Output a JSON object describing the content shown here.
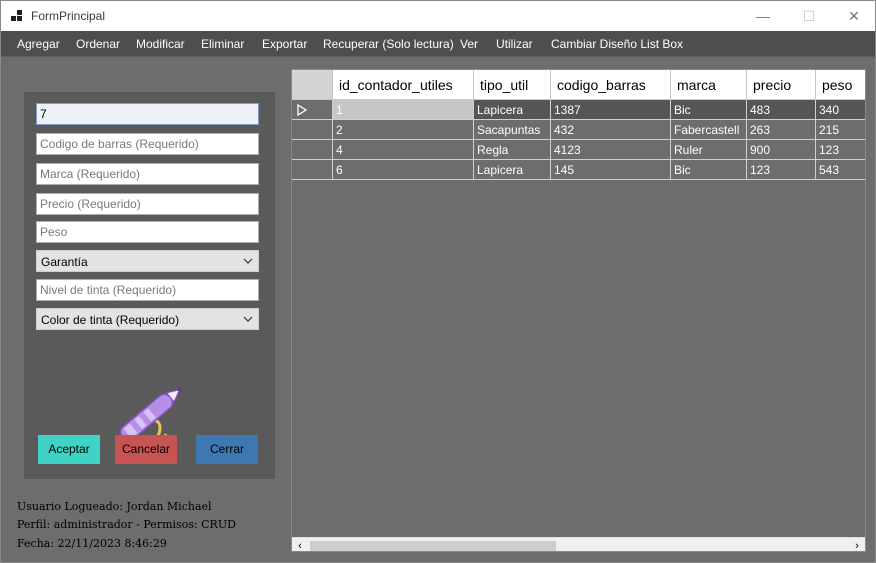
{
  "window": {
    "title": "FormPrincipal"
  },
  "menu": {
    "items": [
      "Agregar",
      "Ordenar",
      "Modificar",
      "Eliminar",
      "Exportar",
      "Recuperar (Solo lectura)",
      "Ver",
      "Utilizar",
      "Cambiar Diseño List Box"
    ]
  },
  "form": {
    "id_value": "7",
    "codigo_placeholder": "Codigo de barras (Requerido)",
    "marca_placeholder": "Marca (Requerido)",
    "precio_placeholder": "Precio (Requerido)",
    "peso_placeholder": "Peso",
    "garantia_selected": "Garantía",
    "tinta_placeholder": "Nivel de tinta (Requerido)",
    "color_selected": "Color de tinta (Requerido)",
    "image_icon": "pen-icon",
    "aceptar_label": "Aceptar",
    "cancelar_label": "Cancelar",
    "cerrar_label": "Cerrar"
  },
  "status": {
    "usuario": "Usuario Logueado: Jordan Michael",
    "perfil": "Perfil: administrador - Permisos: CRUD",
    "fecha": "Fecha: 22/11/2023 8:46:29"
  },
  "grid": {
    "columns": [
      "id_contador_utiles",
      "tipo_util",
      "codigo_barras",
      "marca",
      "precio",
      "peso"
    ],
    "rows": [
      [
        "1",
        "Lapicera",
        "1387",
        "Bic",
        "483",
        "340"
      ],
      [
        "2",
        "Sacapuntas",
        "432",
        "Fabercastell",
        "263",
        "215"
      ],
      [
        "4",
        "Regla",
        "4123",
        "Ruler",
        "900",
        "123"
      ],
      [
        "6",
        "Lapicera",
        "145",
        "Bic",
        "123",
        "543"
      ]
    ],
    "selected_row": 0
  },
  "colors": {
    "menubar": "#4e4e4e",
    "panel": "#5a5a5a",
    "background": "#6d6d6d",
    "aceptar": "#3ed3c4",
    "cancelar": "#c75353",
    "cerrar": "#3d78b1"
  }
}
